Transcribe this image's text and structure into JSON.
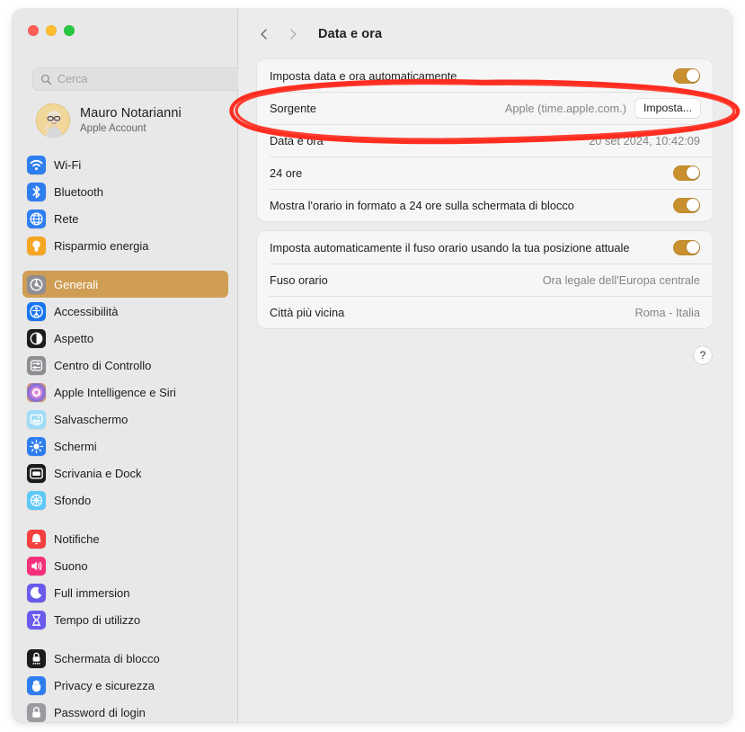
{
  "window": {
    "traffic_lights": [
      "close",
      "minimize",
      "maximize"
    ]
  },
  "sidebar": {
    "search": {
      "placeholder": "Cerca",
      "value": "",
      "icon": "search-icon"
    },
    "account": {
      "name": "Mauro Notarianni",
      "subtitle": "Apple Account",
      "avatar": "memoji-avatar"
    },
    "groups": [
      {
        "items": [
          {
            "label": "Wi-Fi",
            "icon": "wifi-icon",
            "selected": false
          },
          {
            "label": "Bluetooth",
            "icon": "bluetooth-icon",
            "selected": false
          },
          {
            "label": "Rete",
            "icon": "network-icon",
            "selected": false
          },
          {
            "label": "Risparmio energia",
            "icon": "battery-energy-icon",
            "selected": false
          }
        ]
      },
      {
        "items": [
          {
            "label": "Generali",
            "icon": "gear-icon",
            "selected": true
          },
          {
            "label": "Accessibilità",
            "icon": "accessibility-icon",
            "selected": false
          },
          {
            "label": "Aspetto",
            "icon": "appearance-icon",
            "selected": false
          },
          {
            "label": "Centro di Controllo",
            "icon": "control-center-icon",
            "selected": false
          },
          {
            "label": "Apple Intelligence e Siri",
            "icon": "apple-intelligence-icon",
            "selected": false
          },
          {
            "label": "Salvaschermo",
            "icon": "screensaver-icon",
            "selected": false
          },
          {
            "label": "Schermi",
            "icon": "displays-icon",
            "selected": false
          },
          {
            "label": "Scrivania e Dock",
            "icon": "desktop-dock-icon",
            "selected": false
          },
          {
            "label": "Sfondo",
            "icon": "wallpaper-icon",
            "selected": false
          }
        ]
      },
      {
        "items": [
          {
            "label": "Notifiche",
            "icon": "notifications-icon",
            "selected": false
          },
          {
            "label": "Suono",
            "icon": "sound-icon",
            "selected": false
          },
          {
            "label": "Full immersion",
            "icon": "focus-moon-icon",
            "selected": false
          },
          {
            "label": "Tempo di utilizzo",
            "icon": "screen-time-icon",
            "selected": false
          }
        ]
      },
      {
        "items": [
          {
            "label": "Schermata di blocco",
            "icon": "lock-screen-icon",
            "selected": false
          },
          {
            "label": "Privacy e sicurezza",
            "icon": "privacy-security-icon",
            "selected": false
          },
          {
            "label": "Password di login",
            "icon": "login-password-icon",
            "selected": false
          }
        ]
      }
    ]
  },
  "toolbar": {
    "back_icon": "chevron-left-icon",
    "forward_icon": "chevron-right-icon",
    "title": "Data e ora"
  },
  "main": {
    "panels": [
      {
        "rows": [
          {
            "label": "Imposta data e ora automaticamente",
            "value": "",
            "control": "toggle",
            "toggle_on": true
          },
          {
            "label": "Sorgente",
            "value": "Apple (time.apple.com.)",
            "control": "button",
            "button_label": "Imposta...",
            "highlighted": true
          },
          {
            "label": "Data e ora",
            "value": "20 set 2024, 10:42:09",
            "control": "none"
          },
          {
            "label": "24 ore",
            "value": "",
            "control": "toggle",
            "toggle_on": true
          },
          {
            "label": "Mostra l'orario in formato a 24 ore sulla schermata di blocco",
            "value": "",
            "control": "toggle",
            "toggle_on": true
          }
        ]
      },
      {
        "rows": [
          {
            "label": "Imposta automaticamente il fuso orario usando la tua posizione attuale",
            "value": "",
            "control": "toggle",
            "toggle_on": true
          },
          {
            "label": "Fuso orario",
            "value": "Ora legale dell'Europa centrale",
            "control": "none"
          },
          {
            "label": "Città più vicina",
            "value": "Roma - Italia",
            "control": "none"
          }
        ]
      }
    ],
    "help_label": "?"
  },
  "annotation": {
    "type": "ellipse",
    "color": "#ff2d20",
    "target": "Sorgente row"
  },
  "colors": {
    "accent_toggle": "#c8902e",
    "sidebar_selected": "#d09d54",
    "annotation_red": "#ff2d20",
    "window_bg": "#ececec",
    "sidebar_bg": "#e8e8e8",
    "panel_bg": "#f6f6f6"
  }
}
